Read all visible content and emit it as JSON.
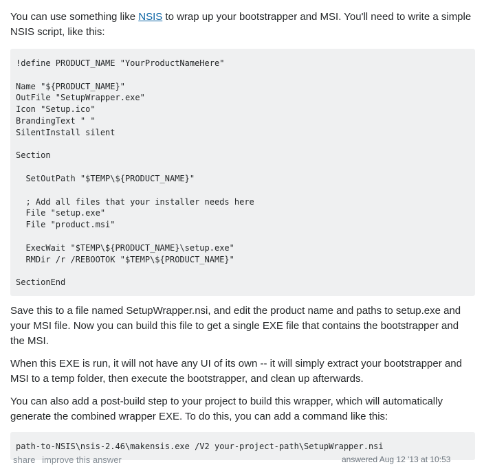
{
  "answer": {
    "intro_before_link": "You can use something like ",
    "intro_link": "NSIS",
    "intro_after_link": " to wrap up your bootstrapper and MSI. You'll need to write a simple NSIS script, like this:",
    "code_block_1": "!define PRODUCT_NAME \"YourProductNameHere\"\n\nName \"${PRODUCT_NAME}\"\nOutFile \"SetupWrapper.exe\"\nIcon \"Setup.ico\"\nBrandingText \" \"\nSilentInstall silent\n\nSection\n\n  SetOutPath \"$TEMP\\${PRODUCT_NAME}\"\n\n  ; Add all files that your installer needs here\n  File \"setup.exe\"\n  File \"product.msi\"\n\n  ExecWait \"$TEMP\\${PRODUCT_NAME}\\setup.exe\"\n  RMDir /r /REBOOTOK \"$TEMP\\${PRODUCT_NAME}\"\n\nSectionEnd",
    "paragraph_save": "Save this to a file named SetupWrapper.nsi, and edit the product name and paths to setup.exe and your MSI file. Now you can build this file to get a single EXE file that contains the bootstrapper and the MSI.",
    "paragraph_run": "When this EXE is run, it will not have any UI of its own -- it will simply extract your bootstrapper and MSI to a temp folder, then execute the bootstrapper, and clean up afterwards.",
    "paragraph_postbuild": "You can also add a post-build step to your project to build this wrapper, which will automatically generate the combined wrapper EXE. To do this, you can add a command like this:",
    "code_block_2": "path-to-NSIS\\nsis-2.46\\makensis.exe /V2 your-project-path\\SetupWrapper.nsi"
  },
  "footer": {
    "share_label": "share",
    "improve_label": "improve this answer",
    "answered_text": "answered Aug 12 '13 at 10:53"
  }
}
